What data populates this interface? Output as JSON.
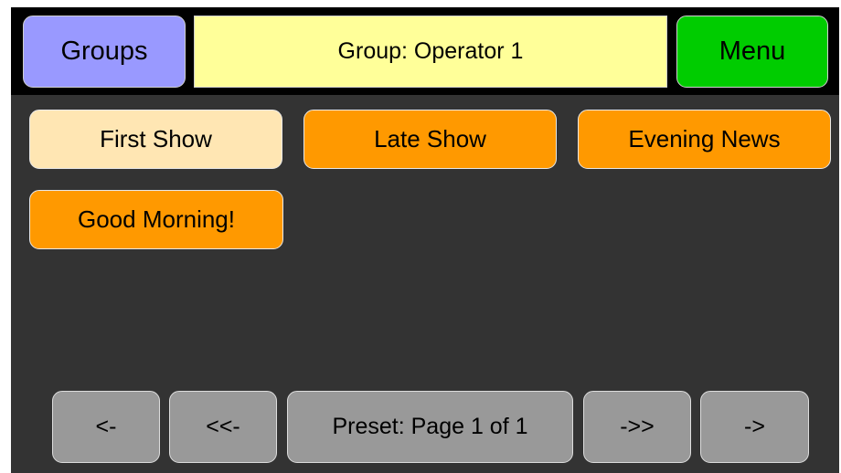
{
  "header": {
    "groups_label": "Groups",
    "group_title": "Group: Operator 1",
    "menu_label": "Menu"
  },
  "presets": [
    {
      "label": "First Show",
      "state": "selected"
    },
    {
      "label": "Late Show",
      "state": "normal"
    },
    {
      "label": "Evening News",
      "state": "normal"
    },
    {
      "label": "Good Morning!",
      "state": "normal"
    }
  ],
  "nav": {
    "prev": "<-",
    "first": "<<-",
    "page_label": "Preset: Page 1 of 1",
    "last": "->>",
    "next": "->"
  },
  "colors": {
    "groups_button": "#9999ff",
    "title_bar": "#ffff99",
    "menu_button": "#00cc00",
    "preset_selected": "#ffe6b3",
    "preset_normal": "#ff9900",
    "nav_button": "#999999",
    "panel_background": "#333333",
    "frame": "#000000"
  }
}
